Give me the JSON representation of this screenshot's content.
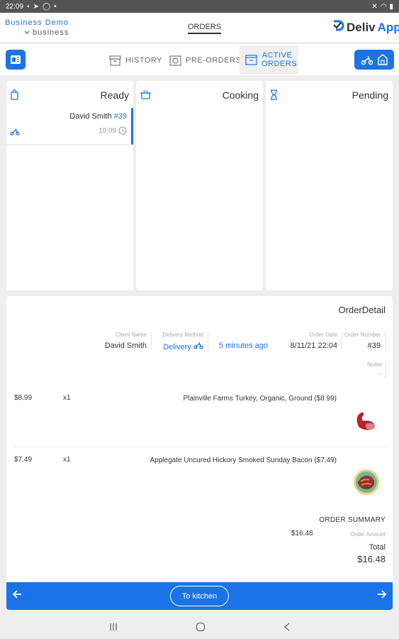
{
  "status_bar": {
    "time": "22:09"
  },
  "header": {
    "business_name": "Business Demo",
    "business_sub": "business",
    "orders_tab": "ORDERS",
    "logo_part1": "Deliv",
    "logo_part2": "App"
  },
  "nav": {
    "history": "HISTORY",
    "preorders": "PRE-ORDERS",
    "active_line1": "ACTIVE",
    "active_line2": "ORDERS"
  },
  "columns": {
    "ready": {
      "title": "Ready",
      "card": {
        "name": "David Smith",
        "number": "#39",
        "time": "10:09"
      }
    },
    "cooking": {
      "title": "Cooking"
    },
    "pending": {
      "title": "Pending"
    }
  },
  "detail": {
    "title": "OrderDetail",
    "client_name_label": "Client Name",
    "client_name": "David Smith",
    "delivery_method_label": "Delivery Method",
    "delivery_method": "Delivery",
    "eta": "5 minutes ago",
    "order_date_label": "Order Date",
    "order_date": "8/11/21 22:04",
    "order_number_label": "Order Number",
    "order_number": "#39",
    "notes_label": "Notes",
    "notes_value": "-",
    "items": [
      {
        "price": "$8.99",
        "qty": "x1",
        "name": "Plainville Farms Turkey, Organic, Ground ($8.99)"
      },
      {
        "price": "$7.49",
        "qty": "x1",
        "name": "Applegate Uncured Hickory Smoked Sunday Bacon ($7.49)"
      }
    ],
    "summary_title": "ORDER SUMMARY",
    "order_amount": "$16.48",
    "order_amount_label": "Order Amount",
    "total_label": "Total",
    "total": "$16.48"
  },
  "actions": {
    "to_kitchen": "To kitchen"
  },
  "colors": {
    "accent": "#1a73e8"
  }
}
